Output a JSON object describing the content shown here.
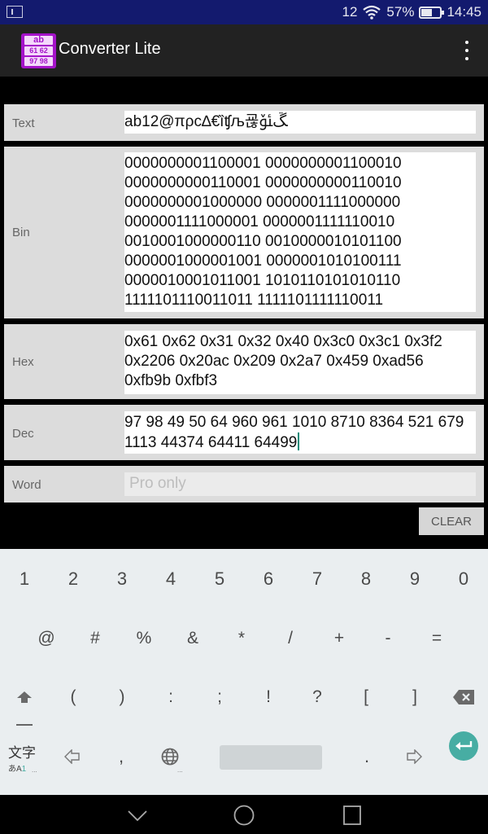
{
  "status_bar": {
    "signal_text": "12",
    "battery_percent_text": "57%",
    "battery_level": 0.57,
    "time": "14:45",
    "icons": [
      "notification-icon",
      "wifi-icon",
      "battery-icon"
    ]
  },
  "app_bar": {
    "title": "Converter Lite",
    "icon_lines": [
      "ab",
      "61 62",
      "97 98"
    ],
    "menu_icon": "overflow-menu-icon"
  },
  "fields": {
    "text": {
      "label": "Text",
      "value": "ab12@πρϲ∆€ȉʧљ굖ﮛﯳ"
    },
    "bin": {
      "label": "Bin",
      "value": "0000000001100001 0000000001100010 0000000000110001 0000000000110010 0000000001000000 0000001111000000 0000001111000001 0000001111110010 0010001000000110 0010000010101100 0000001000001001 0000001010100111 0000010001011001 1010110101010110 1111101110011011 1111101111110011"
    },
    "hex": {
      "label": "Hex",
      "value": "0x61 0x62 0x31 0x32 0x40 0x3c0 0x3c1 0x3f2 0x2206 0x20ac 0x209 0x2a7 0x459 0xad56 0xfb9b 0xfbf3"
    },
    "dec": {
      "label": "Dec",
      "value": "97 98 49 50 64 960 961 1010 8710 8364 521 679 1113 44374 64411 64499"
    },
    "word": {
      "label": "Word",
      "placeholder": "Pro only"
    }
  },
  "clear_button": "CLEAR",
  "keyboard": {
    "row1": [
      "1",
      "2",
      "3",
      "4",
      "5",
      "6",
      "7",
      "8",
      "9",
      "0"
    ],
    "row2": [
      "@",
      "#",
      "%",
      "&",
      "*",
      "/",
      "+",
      "-",
      "="
    ],
    "row3": [
      "(",
      ")",
      ":",
      ";",
      "!",
      "?",
      "[",
      "]"
    ],
    "row4": {
      "lang_main": "文字",
      "lang_sub": "あA",
      "lang_sub_accent": "1",
      "comma": ",",
      "period": ".",
      "more": "..."
    },
    "accent_color": "#47ada3"
  },
  "nav_bar": {
    "icons": [
      "back-icon",
      "home-icon",
      "recents-icon"
    ]
  }
}
